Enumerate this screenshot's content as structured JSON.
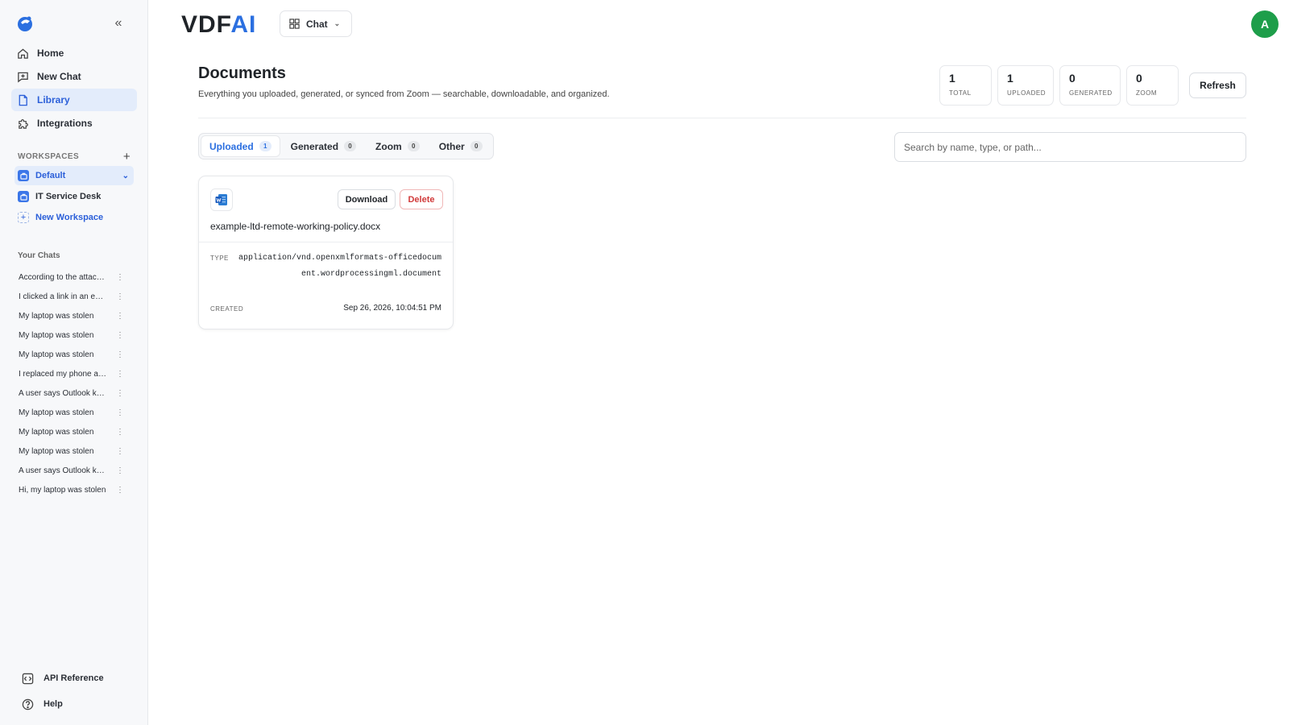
{
  "sidebar": {
    "nav": [
      {
        "label": "Home",
        "icon": "home-icon",
        "active": false
      },
      {
        "label": "New Chat",
        "icon": "new-chat-icon",
        "active": false
      },
      {
        "label": "Library",
        "icon": "document-icon",
        "active": true
      },
      {
        "label": "Integrations",
        "icon": "puzzle-icon",
        "active": false
      }
    ],
    "workspaces_title": "WORKSPACES",
    "workspaces": [
      {
        "label": "Default",
        "active": true
      },
      {
        "label": "IT Service Desk",
        "active": false
      }
    ],
    "new_workspace_label": "New Workspace",
    "chats_title": "Your Chats",
    "chats": [
      "According to the attached document",
      "I clicked a link in an email",
      "My laptop was stolen",
      "My laptop was stolen",
      "My laptop was stolen",
      "I replaced my phone and",
      "A user says Outlook keeps",
      "My laptop was stolen",
      "My laptop was stolen",
      "My laptop was stolen",
      "A user says Outlook keeps",
      "Hi, my laptop was stolen"
    ],
    "bottom": [
      {
        "label": "API Reference",
        "icon": "api-icon"
      },
      {
        "label": "Help",
        "icon": "help-icon"
      }
    ]
  },
  "header": {
    "brand_main": "VDF",
    "brand_accent": "AI",
    "mode_label": "Chat",
    "avatar_initial": "A"
  },
  "main": {
    "title": "Documents",
    "subtitle": "Everything you uploaded, generated, or synced from Zoom — searchable, downloadable, and organized.",
    "stats": [
      {
        "value": "1",
        "label": "TOTAL"
      },
      {
        "value": "1",
        "label": "UPLOADED"
      },
      {
        "value": "0",
        "label": "GENERATED"
      },
      {
        "value": "0",
        "label": "ZOOM"
      }
    ],
    "refresh_label": "Refresh",
    "tabs": [
      {
        "label": "Uploaded",
        "count": "1",
        "active": true
      },
      {
        "label": "Generated",
        "count": "0",
        "active": false
      },
      {
        "label": "Zoom",
        "count": "0",
        "active": false
      },
      {
        "label": "Other",
        "count": "0",
        "active": false
      }
    ],
    "search_placeholder": "Search by name, type, or path...",
    "documents": [
      {
        "name": "example-ltd-remote-working-policy.docx",
        "type_label": "TYPE",
        "type": "application/vnd.openxmlformats-officedocument.wordprocessingml.document",
        "created_label": "CREATED",
        "created": "Sep 26, 2026, 10:04:51 PM",
        "download_label": "Download",
        "delete_label": "Delete",
        "icon": "word-file-icon"
      }
    ]
  },
  "colors": {
    "accent": "#2b6fe0",
    "active_bg": "#e3ecfb",
    "avatar": "#1e9e4a",
    "danger": "#d13a3a"
  }
}
